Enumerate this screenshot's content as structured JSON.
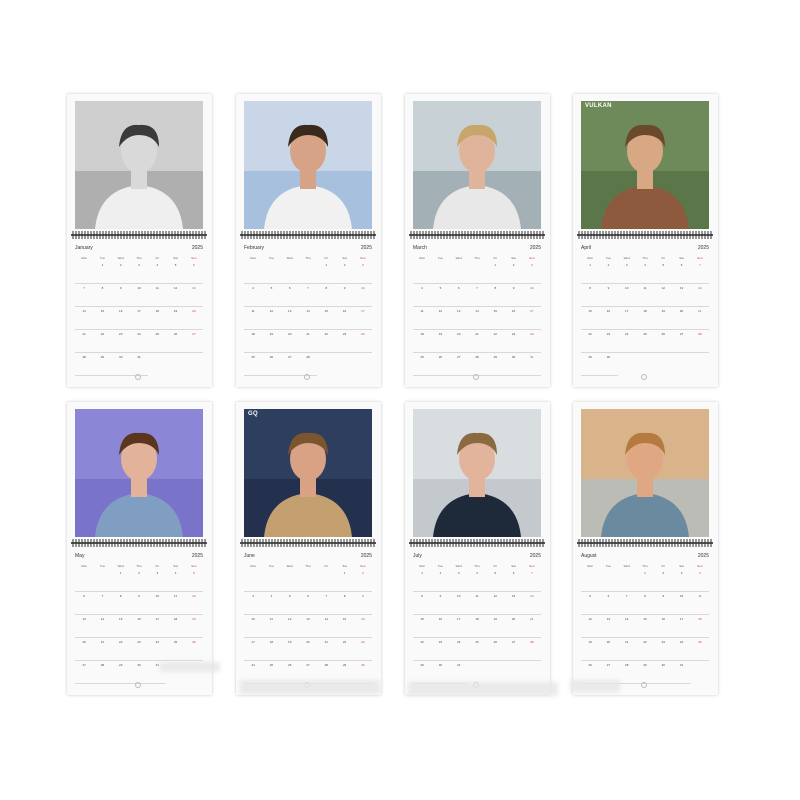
{
  "calendar": {
    "year": "2025",
    "months": [
      {
        "name": "January",
        "start": 2,
        "days": 31,
        "tone": "bw"
      },
      {
        "name": "February",
        "start": 5,
        "days": 28,
        "tone": "color"
      },
      {
        "name": "March",
        "start": 5,
        "days": 31,
        "tone": "color"
      },
      {
        "name": "April",
        "start": 1,
        "days": 30,
        "tone": "color"
      },
      {
        "name": "May",
        "start": 3,
        "days": 31,
        "tone": "color"
      },
      {
        "name": "June",
        "start": 6,
        "days": 30,
        "tone": "color"
      },
      {
        "name": "July",
        "start": 1,
        "days": 31,
        "tone": "color"
      },
      {
        "name": "August",
        "start": 4,
        "days": 31,
        "tone": "color"
      }
    ],
    "weekdays": [
      "Mon",
      "Tue",
      "Wed",
      "Thu",
      "Fri",
      "Sat",
      "Sun"
    ],
    "magazine_labels": {
      "april": "VULKAN",
      "june": "GQ"
    },
    "colors": {
      "sunday_red": "#c43b3b",
      "page_bg": "#fafafa"
    }
  }
}
